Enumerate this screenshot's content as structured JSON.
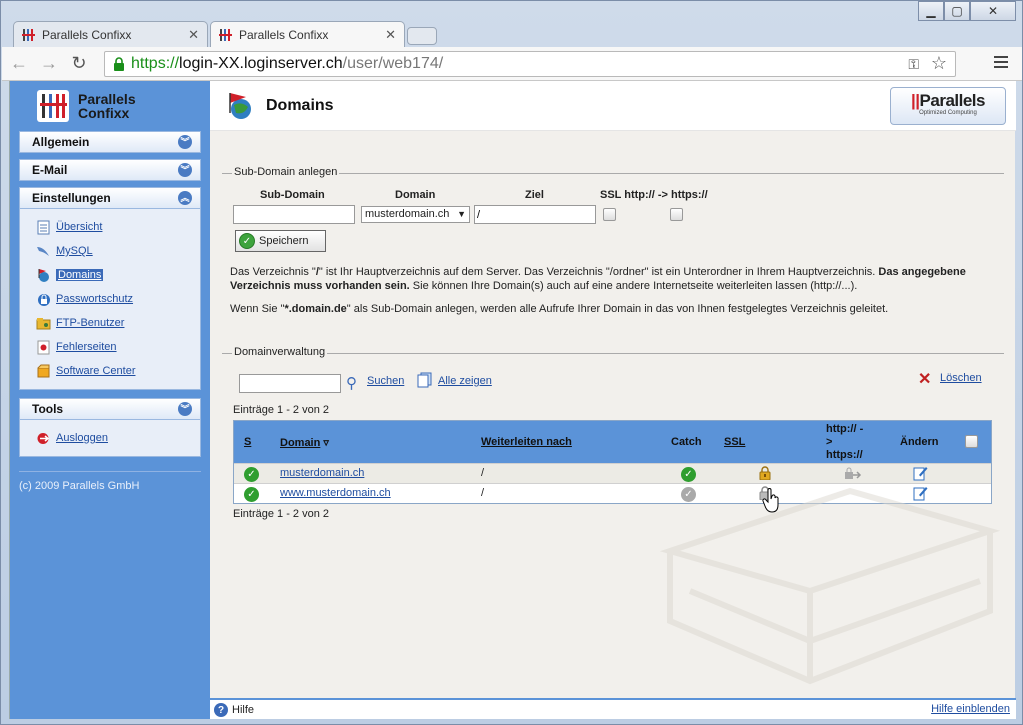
{
  "browser": {
    "tabs": [
      {
        "title": "Parallels Confixx"
      },
      {
        "title": "Parallels Confixx"
      }
    ],
    "url": {
      "scheme": "https://",
      "host": "login-XX.loginserver.ch",
      "path": "/user/web174/"
    }
  },
  "sidebar": {
    "logo_line1": "Parallels",
    "logo_line2": "Confixx",
    "sections": {
      "allgemein": "Allgemein",
      "email": "E-Mail",
      "einstellungen": "Einstellungen",
      "tools": "Tools"
    },
    "items": [
      {
        "label": "Übersicht",
        "icon": "document-icon"
      },
      {
        "label": "MySQL",
        "icon": "dolphin-icon"
      },
      {
        "label": "Domains",
        "icon": "globe-flag-icon"
      },
      {
        "label": "Passwortschutz",
        "icon": "lock-icon"
      },
      {
        "label": "FTP-Benutzer",
        "icon": "folder-user-icon"
      },
      {
        "label": "Fehlerseiten",
        "icon": "error-page-icon"
      },
      {
        "label": "Software Center",
        "icon": "box-icon"
      }
    ],
    "tools_items": [
      {
        "label": "Ausloggen",
        "icon": "logout-icon"
      }
    ],
    "copyright": "(c) 2009 Parallels GmbH"
  },
  "header": {
    "title": "Domains",
    "brand": "Parallels",
    "brand_sub": "Optimized Computing"
  },
  "subdomain": {
    "legend": "Sub-Domain anlegen",
    "col_subdomain": "Sub-Domain",
    "col_domain": "Domain",
    "col_ziel": "Ziel",
    "col_ssl": "SSL http:// -> https://",
    "subdomain_value": "",
    "domain_value": "musterdomain.ch",
    "ziel_value": "/",
    "save_label": "Speichern",
    "info1_a": "Das Verzeichnis \"",
    "info1_b": "/",
    "info1_c": "\" ist Ihr Hauptverzeichnis auf dem Server. Das Verzeichnis \"/ordner\" ist ein Unterordner in Ihrem Hauptverzeichnis. ",
    "info1_d": "Das angegebene Verzeichnis muss vorhanden sein.",
    "info1_e": " Sie können Ihre Domain(s) auch auf eine andere Internetseite weiterleiten lassen (http://...).",
    "info2_a": "Wenn Sie \"",
    "info2_b": "*.domain.de",
    "info2_c": "\" als Sub-Domain anlegen, werden alle Aufrufe Ihrer Domain in das von Ihnen festgelegtes Verzeichnis geleitet."
  },
  "verwaltung": {
    "legend": "Domainverwaltung",
    "search_value": "",
    "search_label": "Suchen",
    "showall_label": "Alle zeigen",
    "delete_label": "Löschen",
    "entries_top": "Einträge 1 - 2 von 2",
    "entries_bottom": "Einträge 1 - 2 von 2",
    "columns": {
      "s": "S",
      "domain": "Domain",
      "redirect": "Weiterleiten nach",
      "catch": "Catch",
      "ssl": "SSL",
      "http_l1": "http:// -",
      "http_l2": ">",
      "http_l3": "https://",
      "edit": "Ändern"
    },
    "rows": [
      {
        "domain": "musterdomain.ch",
        "redirect": "/",
        "catch": "active",
        "ssl": "lock-open"
      },
      {
        "domain": "www.musterdomain.ch",
        "redirect": "/",
        "catch": "inactive",
        "ssl": "lock-grey"
      }
    ]
  },
  "footer": {
    "help": "Hilfe",
    "show_help": "Hilfe einblenden"
  },
  "colors": {
    "sidebar": "#5b93d8",
    "link": "#1f4da0",
    "ok_green": "#2f9e2f"
  }
}
